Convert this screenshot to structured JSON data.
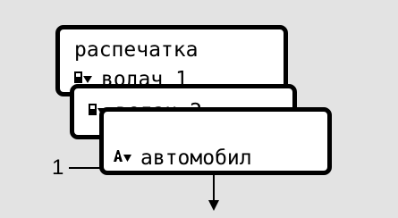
{
  "screens": {
    "print_menu": {
      "title": "распечатка",
      "line2": "водач 1",
      "line2_icon": "card-print-icon"
    },
    "driver2": {
      "label": "водач 2",
      "icon": "card-print-icon"
    },
    "vehicle": {
      "label": "автомобил",
      "icon": "vehicle-print-icon"
    }
  },
  "annotation": {
    "marker": "1"
  },
  "navigation": {
    "icon": "arrow-down-icon"
  },
  "colors": {
    "panel_bg": "#e3e3e3",
    "screen_border": "#000000",
    "screen_bg": "#ffffff"
  }
}
